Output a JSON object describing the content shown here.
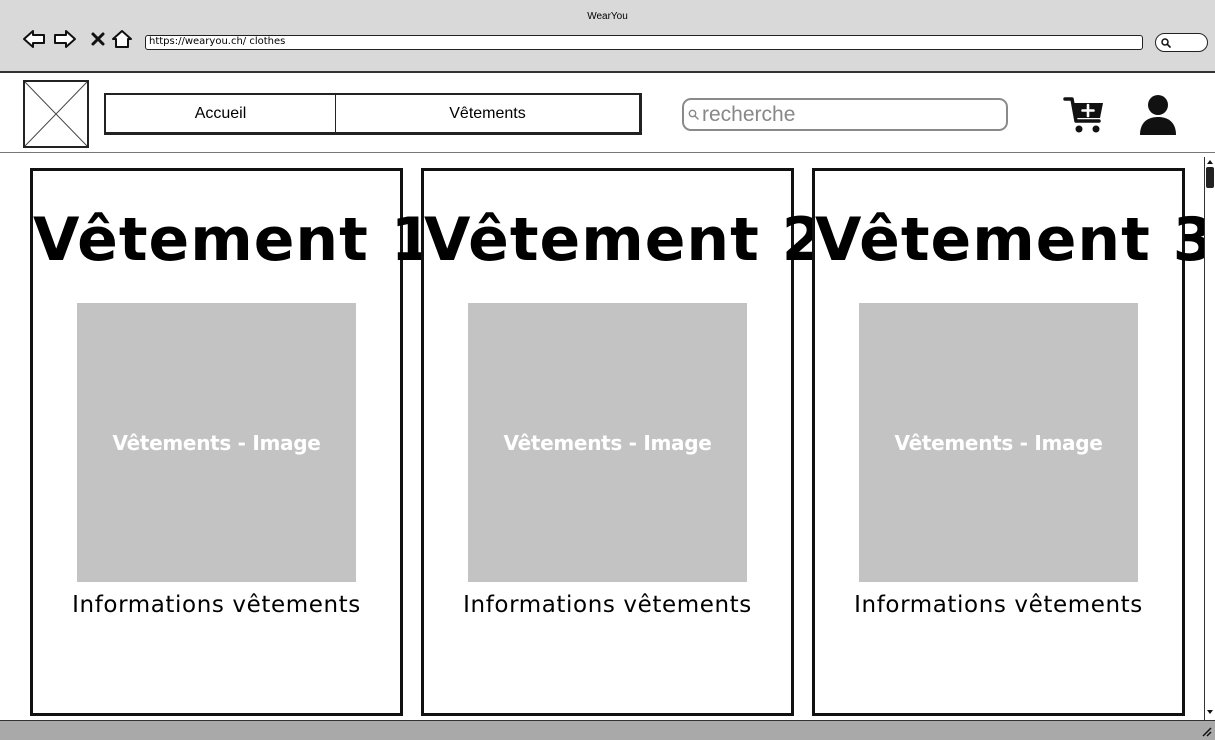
{
  "window": {
    "title": "WearYou"
  },
  "browser": {
    "url": "https://wearyou.ch/ clothes",
    "icons": [
      "back-arrow-icon",
      "forward-arrow-icon",
      "close-icon",
      "home-icon",
      "search-icon"
    ]
  },
  "header": {
    "logo_icon": "image-placeholder-icon",
    "nav": [
      {
        "label": "Accueil"
      },
      {
        "label": "Vêtements"
      }
    ],
    "search": {
      "placeholder": "recherche",
      "icon": "search-icon"
    },
    "cart_icon": "cart-add-icon",
    "user_icon": "user-icon"
  },
  "cards": [
    {
      "title": "Vêtement 1",
      "image_label": "Vêtements - Image",
      "info": "Informations vêtements"
    },
    {
      "title": "Vêtement 2",
      "image_label": "Vêtements - Image",
      "info": "Informations vêtements"
    },
    {
      "title": "Vêtement 3",
      "image_label": "Vêtements - Image",
      "info": "Informations vêtements"
    }
  ],
  "colors": {
    "chrome_bg": "#d9d9d9",
    "image_placeholder": "#c3c3c3",
    "status_bar": "#a9a9a9",
    "border": "#111111"
  }
}
